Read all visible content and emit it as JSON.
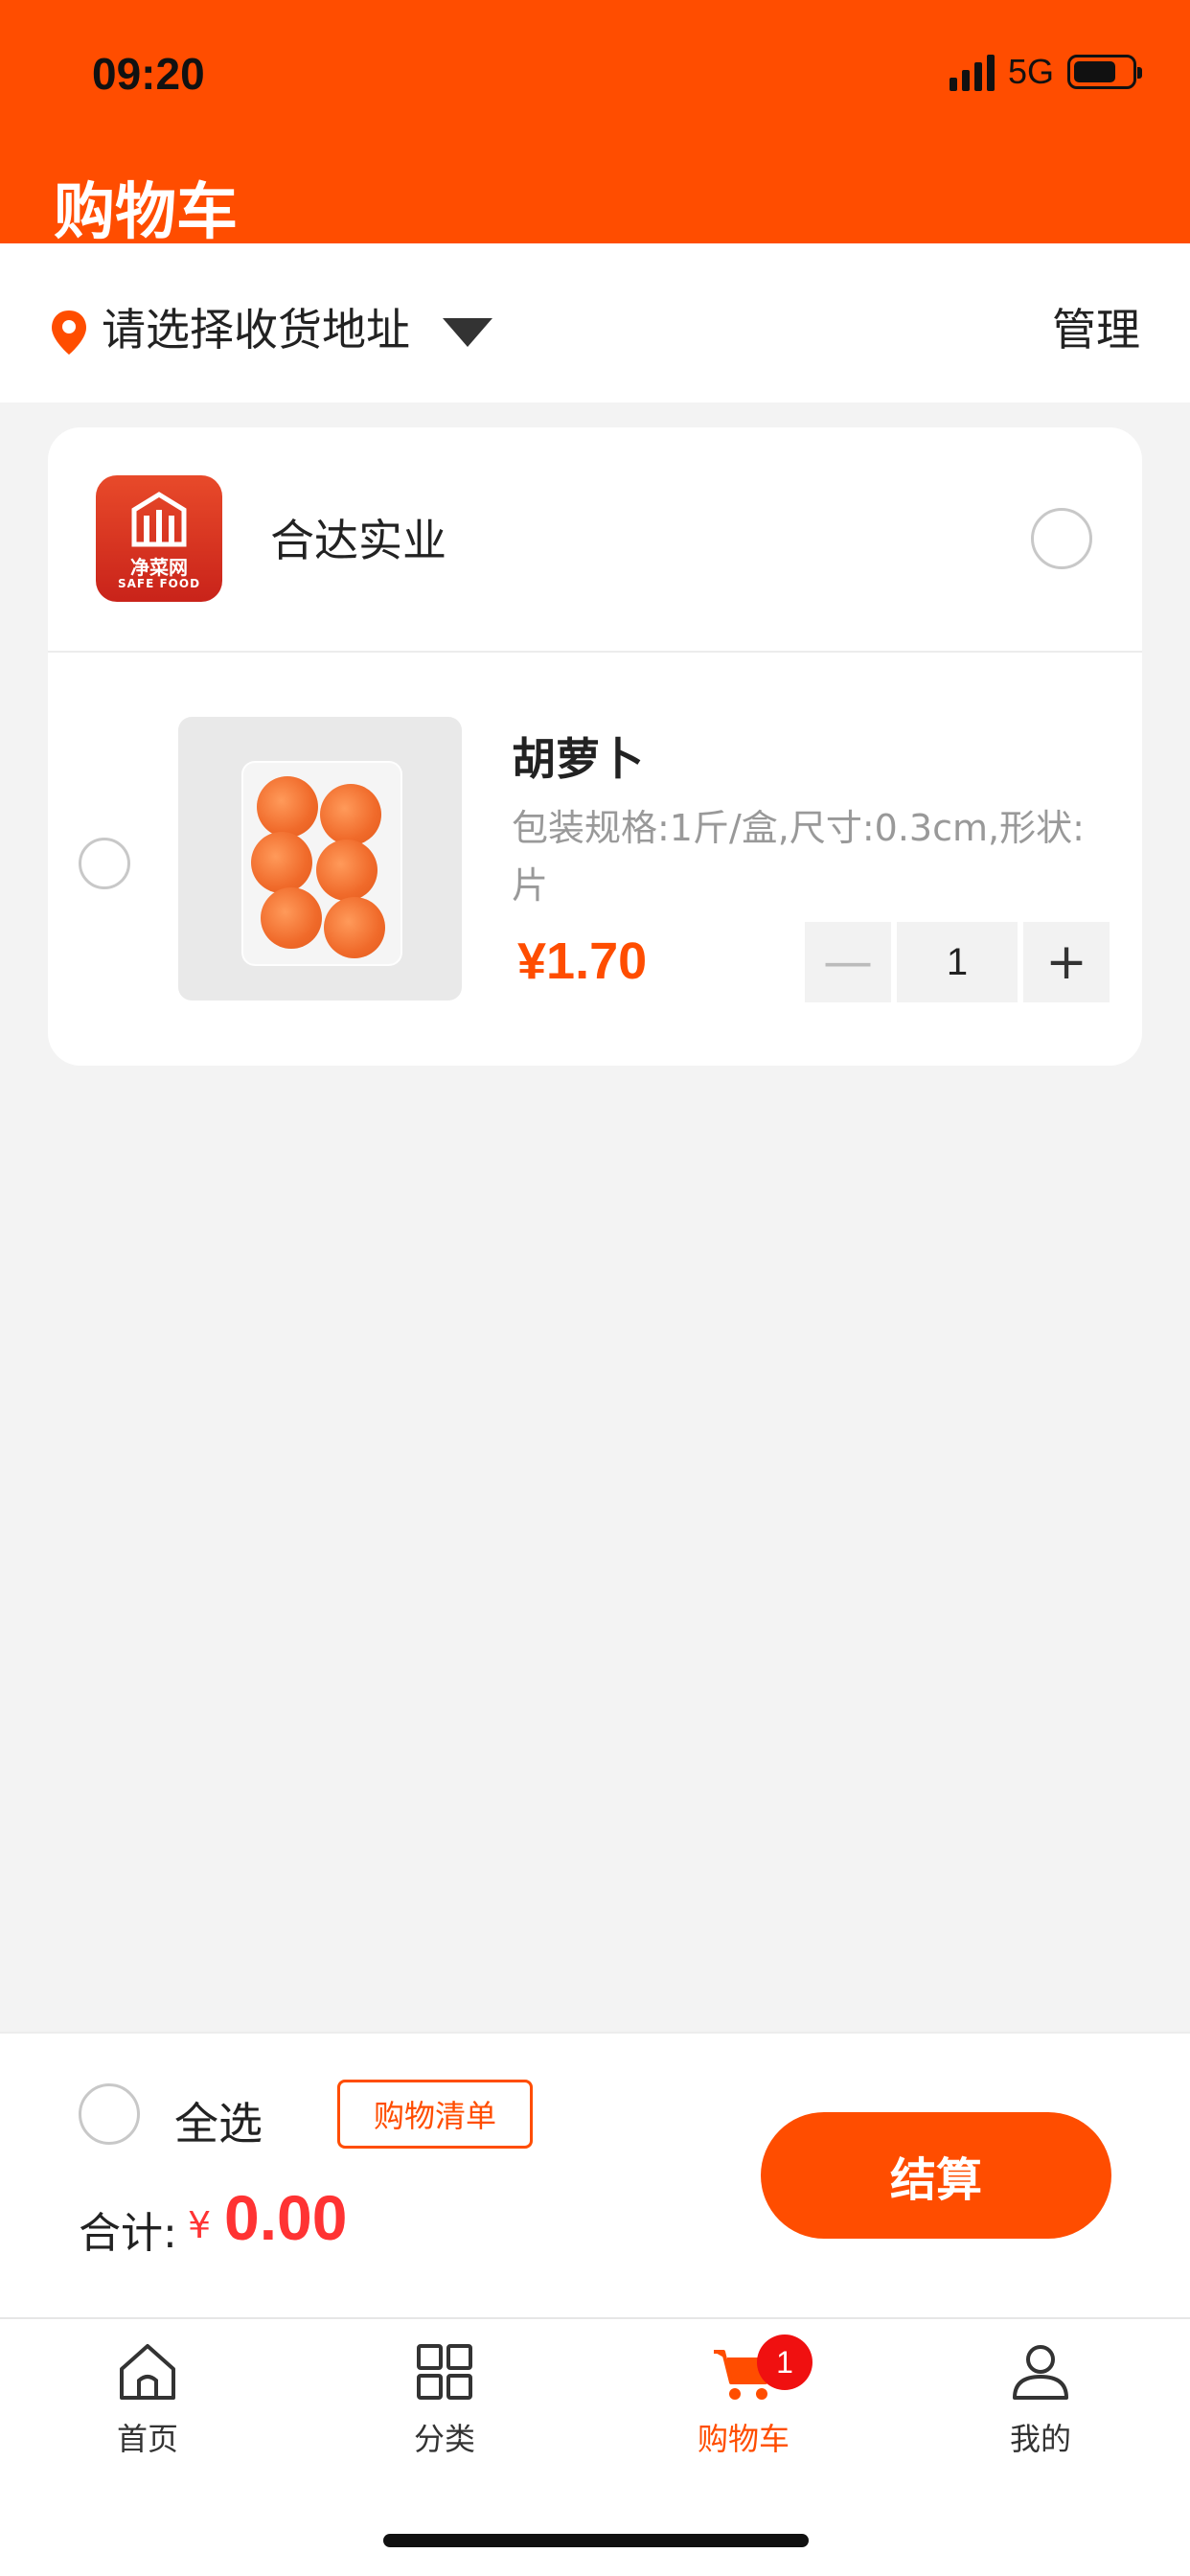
{
  "status": {
    "time": "09:20",
    "network": "5G"
  },
  "header": {
    "title": "购物车"
  },
  "address": {
    "placeholder_text": "请选择收货地址",
    "manage_label": "管理"
  },
  "shop": {
    "name": "合达实业",
    "logo_cn": "净菜网",
    "logo_en": "SAFE FOOD"
  },
  "product": {
    "name": "胡萝卜",
    "spec": "包装规格:1斤/盒,尺寸:0.3cm,形状:片",
    "price": "¥1.70",
    "quantity": "1",
    "minus_label": "—",
    "plus_label": "+"
  },
  "checkout": {
    "select_all_label": "全选",
    "list_button_label": "购物清单",
    "total_label": "合计:",
    "total_currency": "¥",
    "total_value": "0.00",
    "pay_label": "结算"
  },
  "tabbar": {
    "items": [
      {
        "label": "首页",
        "icon": "home-icon"
      },
      {
        "label": "分类",
        "icon": "grid-icon"
      },
      {
        "label": "购物车",
        "icon": "cart-icon",
        "badge": "1",
        "active": true
      },
      {
        "label": "我的",
        "icon": "user-icon"
      }
    ]
  },
  "colors": {
    "brand": "#ff4d00",
    "badge": "#f01010",
    "total": "#ff3333"
  }
}
